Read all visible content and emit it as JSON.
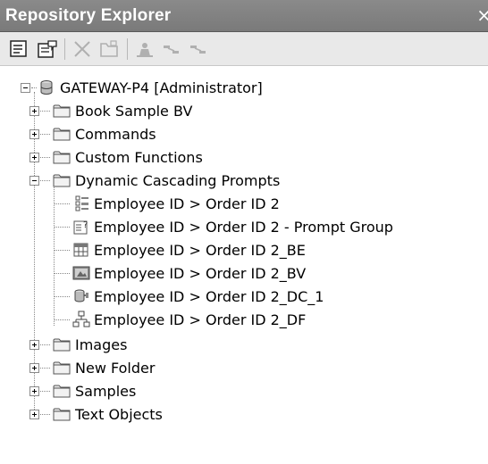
{
  "window": {
    "title": "Repository Explorer",
    "close_glyph": "×"
  },
  "toolbar": {
    "buttons": [
      {
        "icon": "properties-icon",
        "enabled": true
      },
      {
        "icon": "edit-properties-icon",
        "enabled": true
      },
      {
        "icon": "delete-icon",
        "enabled": false
      },
      {
        "icon": "folder-icon",
        "enabled": false
      },
      {
        "icon": "user-icon",
        "enabled": false
      },
      {
        "icon": "link-icon",
        "enabled": false
      },
      {
        "icon": "link-icon",
        "enabled": false
      }
    ]
  },
  "tree": {
    "root": {
      "label": "GATEWAY-P4 [Administrator]",
      "icon": "database-icon",
      "expanded": true
    },
    "folders_top": [
      {
        "label": "Book Sample BV",
        "expanded": false
      },
      {
        "label": "Commands",
        "expanded": false
      },
      {
        "label": "Custom Functions",
        "expanded": false
      },
      {
        "label": "Dynamic Cascading Prompts",
        "expanded": true
      }
    ],
    "prompt_items": [
      {
        "label": "Employee ID > Order ID 2",
        "icon": "prompt-icon"
      },
      {
        "label": "Employee ID > Order ID 2 - Prompt Group",
        "icon": "prompt-group-icon"
      },
      {
        "label": "Employee ID > Order ID 2_BE",
        "icon": "business-element-icon"
      },
      {
        "label": "Employee ID > Order ID 2_BV",
        "icon": "business-view-icon"
      },
      {
        "label": "Employee ID > Order ID 2_DC_1",
        "icon": "data-connection-icon"
      },
      {
        "label": "Employee ID > Order ID 2_DF",
        "icon": "data-foundation-icon"
      }
    ],
    "folders_bottom": [
      {
        "label": "Images",
        "expanded": false
      },
      {
        "label": "New Folder",
        "expanded": false
      },
      {
        "label": "Samples",
        "expanded": false
      },
      {
        "label": "Text Objects",
        "expanded": false
      }
    ]
  }
}
